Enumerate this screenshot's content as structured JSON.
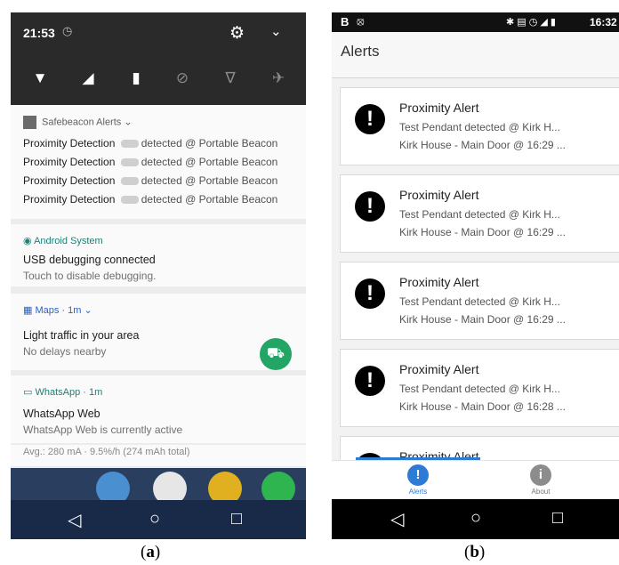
{
  "panel_a": {
    "status_bar": {
      "time": "21:53"
    },
    "quick_settings_icons": [
      "wifi-icon",
      "signal-icon",
      "battery-icon",
      "dnd-icon",
      "flashlight-icon",
      "airplane-icon"
    ],
    "safebeacon": {
      "app_name": "Safebeacon Alerts ⌄",
      "rows": [
        {
          "title": "Proximity Detection",
          "text": "detected @ Portable Beacon"
        },
        {
          "title": "Proximity Detection",
          "text": "detected @ Portable Beacon"
        },
        {
          "title": "Proximity Detection",
          "text": "detected @ Portable Beacon"
        },
        {
          "title": "Proximity Detection",
          "text": "detected @ Portable Beacon"
        }
      ]
    },
    "android_system": {
      "app_name": "Android System",
      "title": "USB debugging connected",
      "text": "Touch to disable debugging."
    },
    "maps": {
      "app_name": "Maps · 1m ⌄",
      "title": "Light traffic in your area",
      "text": "No delays nearby"
    },
    "whatsapp": {
      "app_name": "WhatsApp · 1m",
      "title": "WhatsApp Web",
      "text": "WhatsApp Web is currently active"
    },
    "partial_text": "Avg.: 280 mA · 9.5%/h (274 mAh total)",
    "nav": {
      "back": "◁",
      "home": "○",
      "recents": "□"
    }
  },
  "panel_b": {
    "status_bar": {
      "left_letter": "B",
      "time": "16:32"
    },
    "header_title": "Alerts",
    "alerts": [
      {
        "title": "Proximity Alert",
        "line1": "Test Pendant detected @ Kirk H...",
        "line2": "Kirk House - Main Door @ 16:29 ..."
      },
      {
        "title": "Proximity Alert",
        "line1": "Test Pendant detected @ Kirk H...",
        "line2": "Kirk House - Main Door @ 16:29 ..."
      },
      {
        "title": "Proximity Alert",
        "line1": "Test Pendant detected @ Kirk H...",
        "line2": "Kirk House - Main Door @ 16:29 ..."
      },
      {
        "title": "Proximity Alert",
        "line1": "Test Pendant detected @ Kirk H...",
        "line2": "Kirk House - Main Door @ 16:28 ..."
      },
      {
        "title": "Proximity Alert",
        "line1": "",
        "line2": ""
      }
    ],
    "tabs": [
      {
        "label": "Alerts",
        "icon": "!",
        "color": "#2d7bd4"
      },
      {
        "label": "About",
        "icon": "i",
        "color": "#8c8c8c"
      }
    ],
    "nav": {
      "back": "◁",
      "home": "○",
      "recents": "□"
    }
  },
  "captions": {
    "a": "a",
    "b": "b"
  }
}
